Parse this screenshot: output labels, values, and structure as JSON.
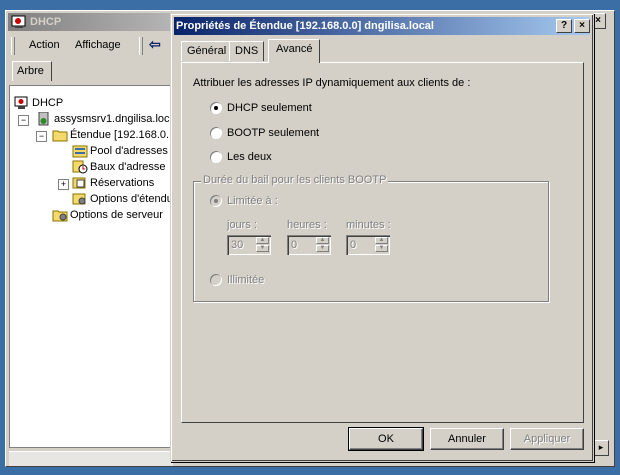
{
  "mmc": {
    "title": "DHCP",
    "menu_action": "Action",
    "menu_affichage": "Affichage",
    "tab_arbre": "Arbre",
    "tree": {
      "root": "DHCP",
      "server": "assysmsrv1.dngilisa.loca",
      "scope": "Étendue [192.168.0.",
      "pool": "Pool d'adresses",
      "leases": "Baux d'adresse",
      "reservations": "Réservations",
      "scope_options": "Options d'étendu",
      "server_options": "Options de serveur"
    }
  },
  "dialog": {
    "title": "Propriétés de Étendue [192.168.0.0] dngilisa.local",
    "help_btn": "?",
    "close_btn": "×",
    "tabs": [
      "Général",
      "DNS",
      "Avancé"
    ],
    "active_tab": "Avancé",
    "assign_label": "Attribuer les adresses IP dynamiquement aux clients de :",
    "options": [
      "DHCP seulement",
      "BOOTP seulement",
      "Les deux"
    ],
    "selected_option": "DHCP seulement",
    "lease_group": {
      "legend": "Durée du bail pour les clients BOOTP",
      "limited_label": "Limitée à :",
      "days_label": "jours :",
      "hours_label": "heures :",
      "minutes_label": "minutes :",
      "days_value": "30",
      "hours_value": "0",
      "minutes_value": "0",
      "unlimited_label": "Illimitée",
      "enabled": false
    },
    "buttons": {
      "ok": "OK",
      "cancel": "Annuler",
      "apply": "Appliquer"
    }
  },
  "colors": {
    "desktop": "#3a6ea5",
    "active_title": "#0a246a",
    "inactive_title": "#808080",
    "face": "#d4d0c8"
  }
}
